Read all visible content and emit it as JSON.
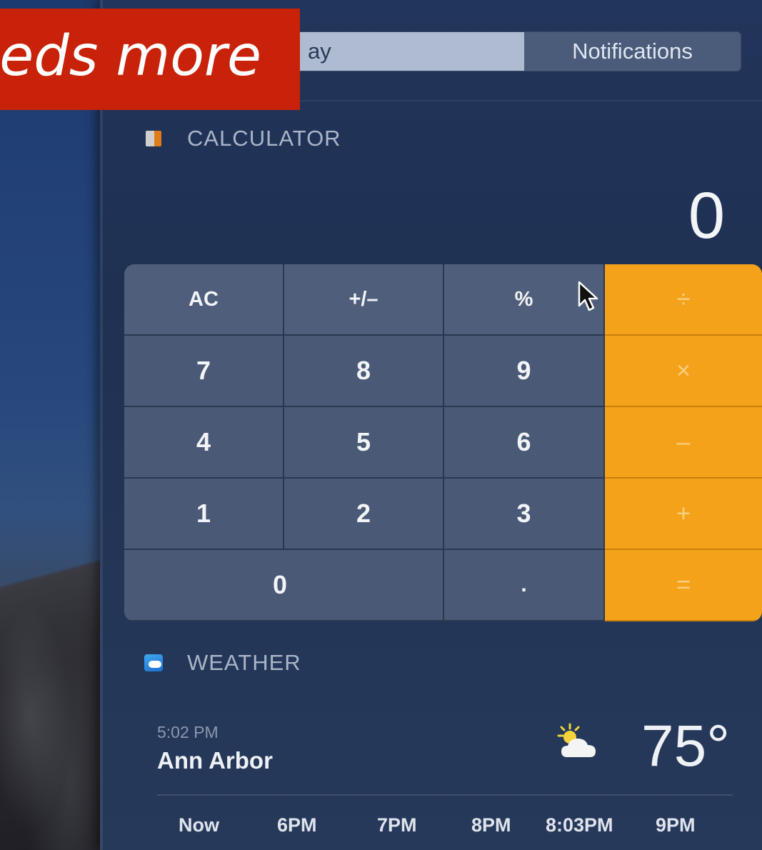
{
  "segmented_control": {
    "today_label": "ay",
    "notifications_label": "Notifications"
  },
  "banner": {
    "text": "eds more"
  },
  "calculator": {
    "header": "CALCULATOR",
    "display": "0",
    "keys": {
      "ac": "AC",
      "plus_minus": "+/–",
      "percent": "%",
      "divide": "÷",
      "seven": "7",
      "eight": "8",
      "nine": "9",
      "multiply": "×",
      "four": "4",
      "five": "5",
      "six": "6",
      "minus": "–",
      "one": "1",
      "two": "2",
      "three": "3",
      "plus": "+",
      "zero": "0",
      "dot": ".",
      "equals": "="
    }
  },
  "weather": {
    "header": "WEATHER",
    "time": "5:02 PM",
    "city": "Ann Arbor",
    "temperature": "75°",
    "condition_icon": "partly-sunny-icon",
    "hours": [
      "Now",
      "6PM",
      "7PM",
      "8PM",
      "8:03PM",
      "9PM"
    ]
  },
  "colors": {
    "operator_key": "#f5a21b",
    "banner": "#c8220a"
  }
}
